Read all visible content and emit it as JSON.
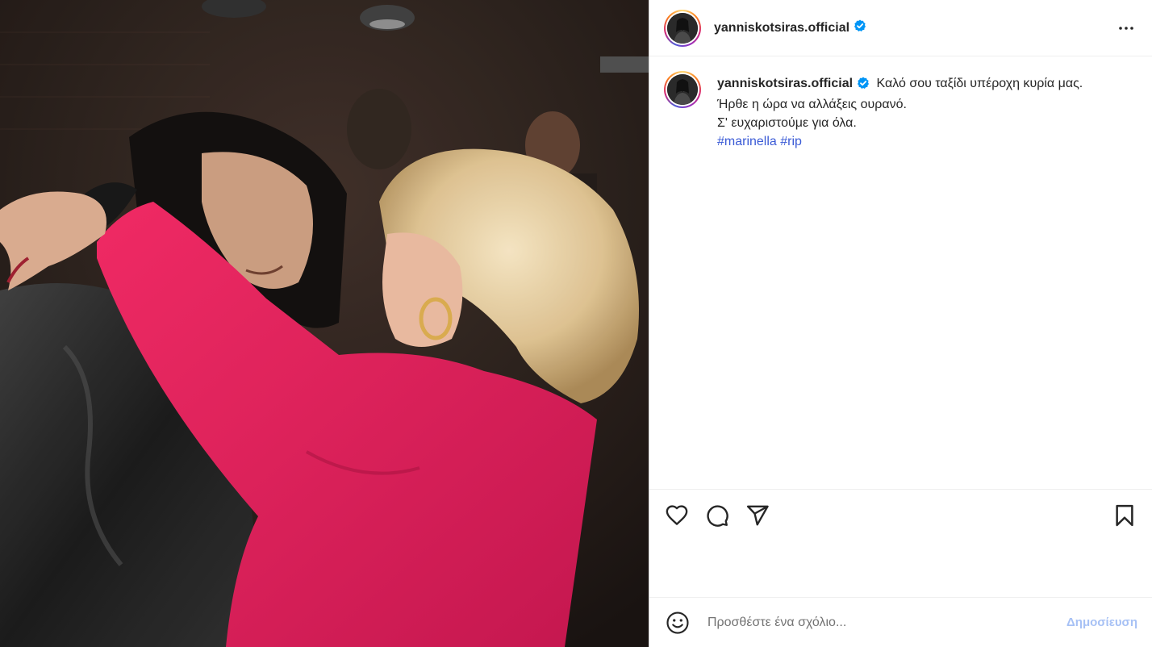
{
  "post": {
    "username": "yanniskotsiras.official",
    "verified": true,
    "photo_alt": "Δύο άνθρωποι αγκαλιάζονται"
  },
  "caption": {
    "username": "yanniskotsiras.official",
    "line1": "Καλό σου ταξίδι υπέροχη κυρία μας.",
    "line2": "Ήρθε η ώρα να αλλάξεις ουρανό.",
    "line3": "Σ' ευχαριστούμε για όλα.",
    "hashtag1": "#marinella",
    "hashtag2": "#rip"
  },
  "actions": {
    "icons": [
      "heart-icon",
      "comment-icon",
      "share-icon",
      "bookmark-icon"
    ]
  },
  "comment": {
    "placeholder": "Προσθέστε ένα σχόλιο...",
    "post_label": "Δημοσίευση"
  },
  "colors": {
    "hashtag": "#3b5bd6",
    "verified": "#0095f6",
    "post_button_disabled": "#a7c1f5"
  }
}
